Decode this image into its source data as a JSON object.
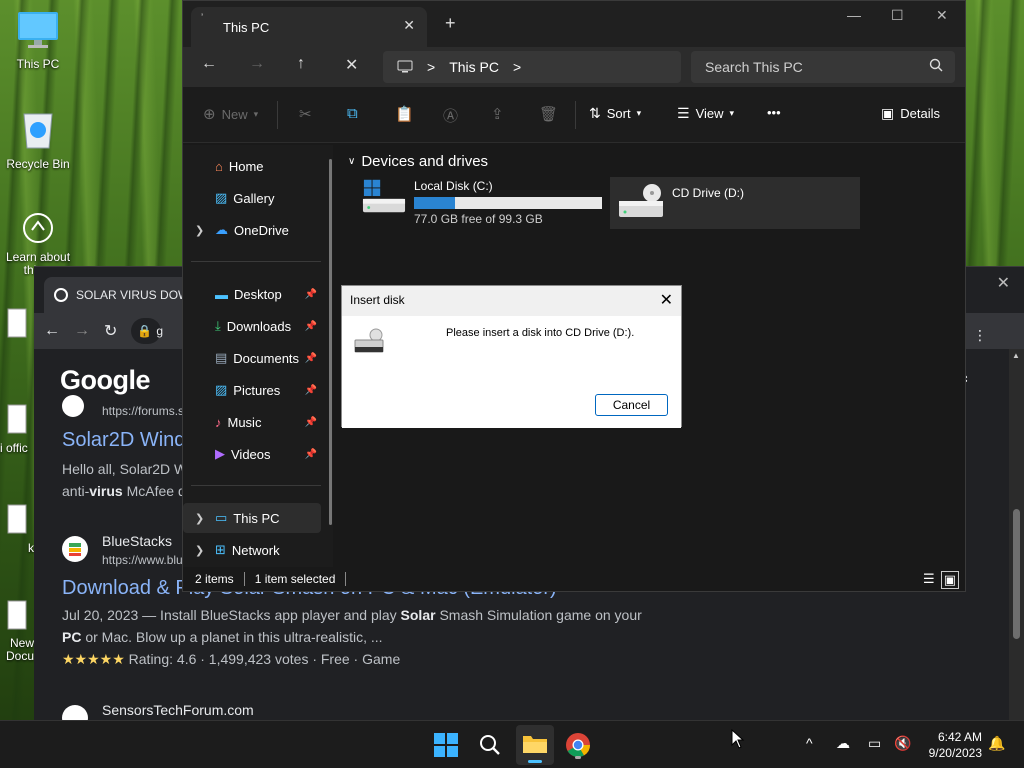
{
  "desktop": {
    "icons": [
      {
        "label": "This PC",
        "icon": "monitor-icon"
      },
      {
        "label": "Recycle Bin",
        "icon": "recycle-bin-icon"
      },
      {
        "label": "Learn about this p",
        "icon": "learn-icon"
      },
      {
        "label": "i offic",
        "icon": "document-icon"
      },
      {
        "label": "k",
        "icon": "document-icon"
      },
      {
        "label": "New Docu",
        "icon": "document-icon"
      }
    ]
  },
  "browser": {
    "tab_title": "SOLAR VIRUS DOW",
    "omnibox_partial": "g",
    "google_logo": "Google",
    "results": [
      {
        "url": "https://forums.s",
        "title": "Solar2D Wind",
        "snippet_line1_pre": "Hello all, Solar2D W",
        "snippet_line2_pre": "anti-",
        "snippet_line2_bold": "virus",
        "snippet_line2_post": " McAfee d"
      },
      {
        "site": "BlueStacks",
        "url": "https://www.blu",
        "title": "Download & Play Solar Smash on PC & Mac (Emulator)",
        "snippet1_pre": "Jul 20, 2023 — Install BlueStacks app player and play ",
        "snippet1_bold": "Solar",
        "snippet1_post": " Smash Simulation game on your",
        "snippet2_bold": "PC",
        "snippet2_post": " or Mac. Blow up a planet in this ultra-realistic, ...",
        "stars": "★★★★★",
        "rating": "Rating: 4.6 · 1,499,423 votes · Free · Game"
      },
      {
        "site": "SensorsTechForum.com"
      }
    ]
  },
  "explorer": {
    "tab_title": "This PC",
    "new_tab": "+",
    "address": {
      "location": "This PC",
      "separator": ">"
    },
    "search_placeholder": "Search This PC",
    "toolbar": {
      "new_label": "New",
      "sort_label": "Sort",
      "view_label": "View",
      "more_label": "•••",
      "details_label": "Details"
    },
    "nav": {
      "home": "Home",
      "gallery": "Gallery",
      "onedrive": "OneDrive",
      "desktop": "Desktop",
      "downloads": "Downloads",
      "documents": "Documents",
      "pictures": "Pictures",
      "music": "Music",
      "videos": "Videos",
      "this_pc": "This PC",
      "network": "Network"
    },
    "group_header": "Devices and drives",
    "drives": [
      {
        "name": "Local Disk (C:)",
        "free_text": "77.0 GB free of 99.3 GB",
        "used_fraction": 0.22
      },
      {
        "name": "CD Drive (D:)"
      }
    ],
    "status": {
      "items": "2 items",
      "selected": "1 item selected"
    }
  },
  "dialog": {
    "title": "Insert disk",
    "message": "Please insert a disk into CD Drive (D:).",
    "cancel": "Cancel",
    "close": "✕"
  },
  "taskbar": {
    "time": "6:42 AM",
    "date": "9/20/2023",
    "tray_overflow": "^"
  },
  "colors": {
    "accent": "#0067c0",
    "drive_bar": "#2a84d2",
    "link": "#8ab4f8"
  }
}
